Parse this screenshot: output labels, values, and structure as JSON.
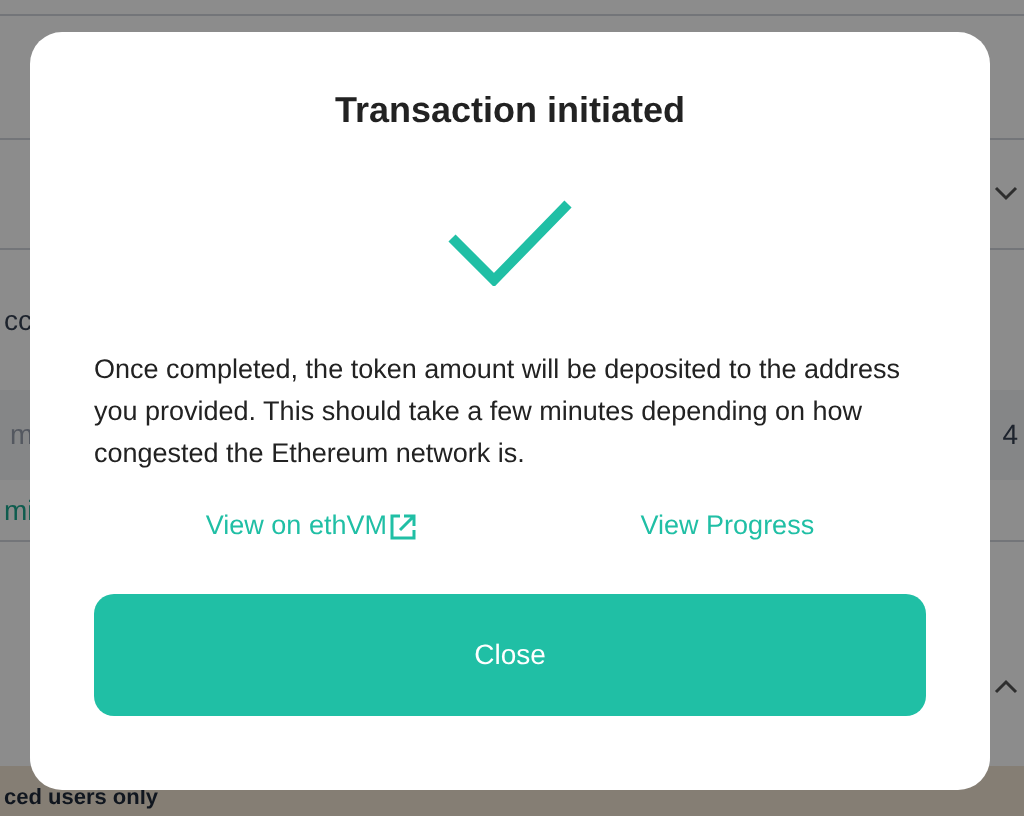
{
  "background": {
    "fragments": [
      {
        "kind": "text",
        "text": "cc"
      },
      {
        "kind": "muted",
        "text": "m"
      },
      {
        "kind": "number",
        "text": "4"
      },
      {
        "kind": "link",
        "text": "mi"
      },
      {
        "kind": "banner",
        "text": "ced users only"
      }
    ]
  },
  "dialog": {
    "title": "Transaction initiated",
    "message": "Once completed, the token amount will be deposited to the address you provided. This should take a few minutes depending on how congested the Ethereum network is.",
    "links": [
      {
        "label": "View on ethVM",
        "external": true
      },
      {
        "label": "View Progress",
        "external": false
      }
    ],
    "button": "Close"
  }
}
